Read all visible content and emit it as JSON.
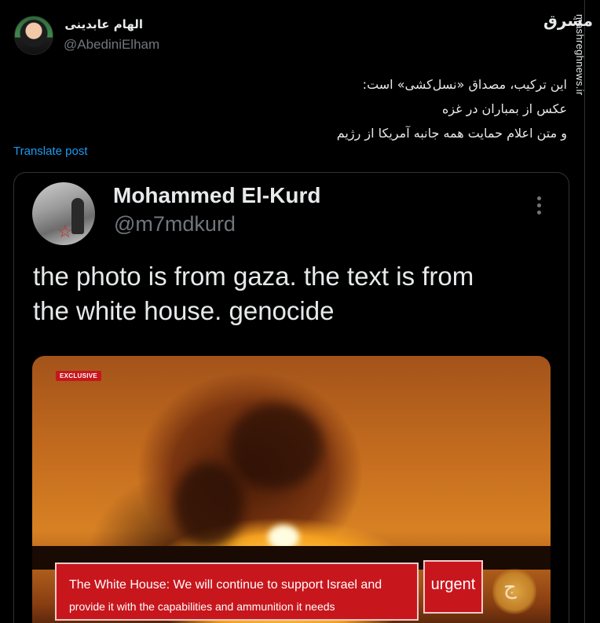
{
  "tweet": {
    "author": {
      "display_name": "الهام عابدینی",
      "handle": "@AbediniElham"
    },
    "text_lines": [
      "این ترکیب، مصداق «نسل‌کشی» است:",
      "عکس از بمباران  در  غزه",
      "و متن اعلام حمایت همه جانبه آمریکا از رژیم"
    ],
    "translate_label": "Translate post"
  },
  "watermark": {
    "logo_text": "مشرق",
    "site": "mashreghnews.ir"
  },
  "quoted": {
    "author": {
      "display_name": "Mohammed El-Kurd",
      "handle": "@m7mdkurd"
    },
    "text_lines": [
      "the photo is from gaza. the text is from",
      "the white house. genocide"
    ],
    "media": {
      "badge": "EXCLUSIVE",
      "caption_lines": [
        "The White House: We will continue to support Israel and",
        "provide it with the capabilities and ammunition it needs"
      ],
      "urgent_label": "urgent"
    }
  },
  "icons": {
    "more": "more-horizontal-icon",
    "star": "star-icon",
    "network_logo": "al-jazeera-logo"
  },
  "colors": {
    "background": "#000000",
    "text": "#e7e9ea",
    "secondary_text": "#71767b",
    "link": "#1d9bf0",
    "border": "#2f3336",
    "news_red": "#c8161d"
  }
}
